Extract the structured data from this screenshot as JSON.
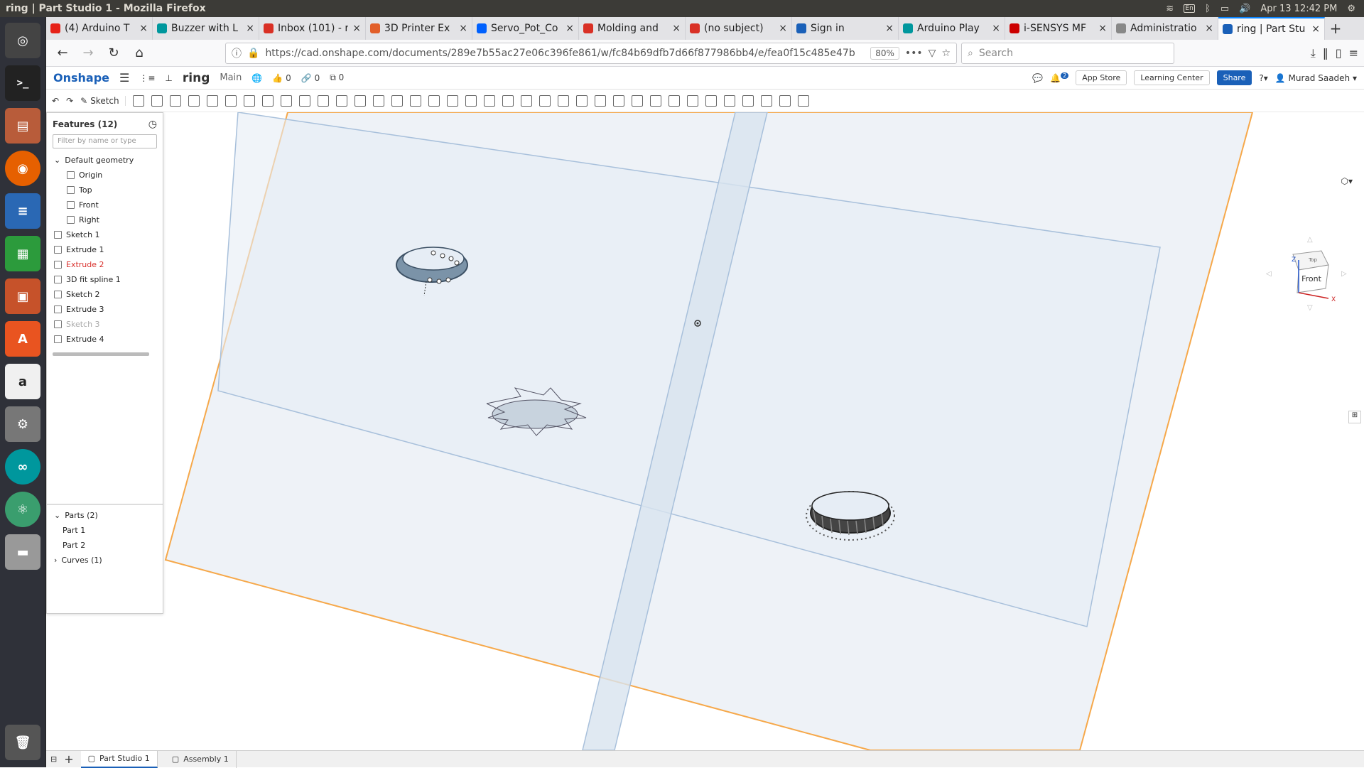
{
  "window": {
    "title": "ring | Part Studio 1 - Mozilla Firefox",
    "lang": "En",
    "clock": "Apr 13 12:42 PM"
  },
  "tabs": [
    {
      "label": "(4) Arduino T",
      "color": "#e62117"
    },
    {
      "label": "Buzzer with L",
      "color": "#00979d"
    },
    {
      "label": "Inbox (101) - r",
      "color": "#d93025"
    },
    {
      "label": "3D Printer Ex",
      "color": "#e25f2a"
    },
    {
      "label": "Servo_Pot_Co",
      "color": "#0061fe"
    },
    {
      "label": "Molding and",
      "color": "#d93025"
    },
    {
      "label": "(no subject)",
      "color": "#d93025"
    },
    {
      "label": "Sign in",
      "color": "#1a60b8"
    },
    {
      "label": "Arduino Play",
      "color": "#00979d"
    },
    {
      "label": "i-SENSYS MF",
      "color": "#cc0000"
    },
    {
      "label": "Administratio",
      "color": "#888888"
    },
    {
      "label": "ring | Part Stu",
      "color": "#1a60b8",
      "active": true
    }
  ],
  "nav": {
    "url": "https://cad.onshape.com/documents/289e7b55ac27e06c396fe861/w/fc84b69dfb7d66f877986bb4/e/fea0f15c485e47b",
    "zoom": "80%",
    "search_placeholder": "Search"
  },
  "onshape": {
    "brand": "Onshape",
    "doc": "ring",
    "workspace": "Main",
    "likes": "0",
    "links": "0",
    "copies": "0",
    "notif_count": "2",
    "app_store": "App Store",
    "learning": "Learning Center",
    "share": "Share",
    "user": "Murad Saadeh"
  },
  "toolbar": {
    "sketch": "Sketch"
  },
  "features": {
    "header": "Features (12)",
    "filter_placeholder": "Filter by name or type",
    "default_geometry": "Default geometry",
    "items": [
      {
        "label": "Origin",
        "kind": "plain",
        "indent": true
      },
      {
        "label": "Top",
        "kind": "plain",
        "indent": true
      },
      {
        "label": "Front",
        "kind": "plain",
        "indent": true
      },
      {
        "label": "Right",
        "kind": "plain",
        "indent": true
      },
      {
        "label": "Sketch 1",
        "kind": "plain"
      },
      {
        "label": "Extrude 1",
        "kind": "plain"
      },
      {
        "label": "Extrude 2",
        "kind": "red"
      },
      {
        "label": "3D fit spline 1",
        "kind": "plain"
      },
      {
        "label": "Sketch 2",
        "kind": "plain"
      },
      {
        "label": "Extrude 3",
        "kind": "plain"
      },
      {
        "label": "Sketch 3",
        "kind": "dim"
      },
      {
        "label": "Extrude 4",
        "kind": "plain"
      }
    ]
  },
  "parts": {
    "header": "Parts (2)",
    "items": [
      "Part 1",
      "Part 2"
    ],
    "curves": "Curves (1)"
  },
  "bottom_tabs": [
    {
      "label": "Part Studio 1",
      "active": true
    },
    {
      "label": "Assembly 1",
      "active": false
    }
  ],
  "viewcube": {
    "face": "Front",
    "top": "Top",
    "axis_x": "X",
    "axis_z": "Z"
  }
}
